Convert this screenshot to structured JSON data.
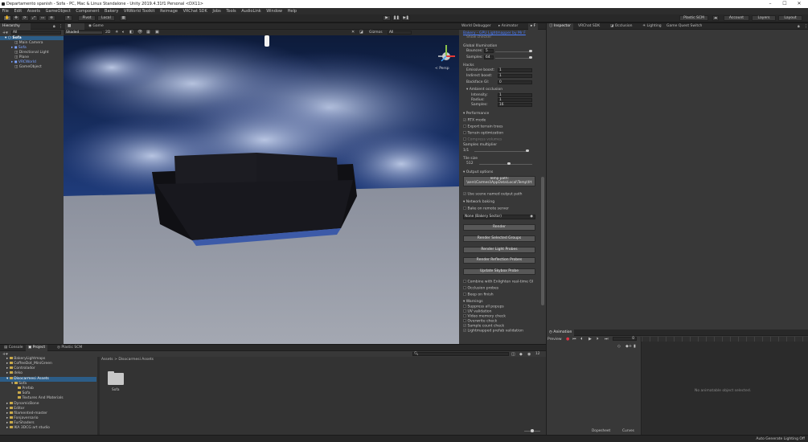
{
  "window": {
    "title": "Departamento spanish - Sofa - PC, Mac & Linux Standalone - Unity 2019.4.31f1 Personal <DX11>",
    "minimize": "–",
    "maximize": "☐",
    "close": "✕"
  },
  "menu": [
    "File",
    "Edit",
    "Assets",
    "GameObject",
    "Component",
    "Bakery",
    "VRWorld Toolkit",
    "Reimage",
    "VRChat SDK",
    "Jobs",
    "Tools",
    "AudioLink",
    "Window",
    "Help"
  ],
  "toolbar": {
    "pivot": "Pivot",
    "local": "Local",
    "plastic": "Plastic SCM",
    "account": "Account",
    "layers": "Layers",
    "layout": "Layout"
  },
  "hierarchy": {
    "tab": "Hierarchy",
    "search_placeholder": "All",
    "items": [
      "Sofa",
      "Main Camera",
      "Sofa",
      "Directional Light",
      "Plane",
      "VRCWorld",
      "GameObject"
    ]
  },
  "scene": {
    "tabs": [
      "Scene",
      "Game"
    ],
    "shading": "Shaded",
    "mode2d": "2D",
    "gizmos": "Gizmos",
    "search_placeholder": "All",
    "persp": "< Persp"
  },
  "bakery": {
    "tabs": [
      "World Debugger",
      "Animator",
      "F"
    ],
    "header_link": "Bakery - GPU Lightmapper by Mr F",
    "cutoff": "Show checker",
    "global_illumination": "Global Illumination",
    "bounces_label": "Bounces:",
    "bounces_value": "5",
    "samples_label": "Samples:",
    "samples_value": "64",
    "hacks": "Hacks",
    "emissive_label": "Emissive boost:",
    "emissive_value": "1",
    "indirect_label": "Indirect boost:",
    "indirect_value": "1",
    "backface_label": "Backface GI:",
    "backface_value": "0",
    "ao": "Ambient occlusion",
    "intensity_label": "Intensity:",
    "intensity_value": "1",
    "radius_label": "Radius:",
    "radius_value": "1",
    "ao_samples_label": "Samples:",
    "ao_samples_value": "16",
    "performance": "Performance",
    "rtx": "RTX mode",
    "export_terrain": "Export terrain trees",
    "terrain_opt": "Terrain optimization",
    "compress": "Compress volumes",
    "samples_mult": "Samples multiplier",
    "samples_mult_value": "1/1",
    "tile_size": "Tile size",
    "tile_value": "512",
    "output_options": "Output options",
    "temp_path_label": "Temp path:",
    "temp_path": "\\sers\\Carmesi\\AppData\\Local\\Temp\\frt",
    "use_scene_named": "Use scene named output path",
    "network_baking": "Network baking",
    "bake_remote": "Bake on remote server",
    "sector": "None (Bakery Sector)",
    "buttons": [
      "Render",
      "Render Selected Groups",
      "Render Light Probes",
      "Render Reflection Probes",
      "Update Skybox Probe"
    ],
    "combine": "Combine with Enlighten real-time GI",
    "occlusion_probes": "Occlusion probes",
    "beep": "Beep on finish",
    "warnings": "Warnings",
    "warn_items": [
      "Suppress all popups",
      "UV validation",
      "Video memory check",
      "Overwrite check",
      "Sample count check",
      "Lightmapped prefab validation"
    ]
  },
  "inspector": {
    "tabs": [
      "Inspector",
      "VRChat SDK",
      "Occlusion",
      "Lighting",
      "Game Quest Switch"
    ]
  },
  "animation": {
    "tab": "Animation",
    "preview": "Preview",
    "frame": "0",
    "empty": "No animatable object selected.",
    "dopesheet": "Dopesheet",
    "curves": "Curves"
  },
  "project": {
    "tabs": [
      "Console",
      "Project",
      "Plastic SCM"
    ],
    "search_placeholder": "",
    "count": "12",
    "tree": [
      "BakeryLightmaps",
      "CoffeeDot_MiniGreen",
      "Controlador",
      "deko",
      "Disocarmesi Assets",
      "Sofa",
      "Prefab",
      "Sofa",
      "Textures And Materials",
      "DynamicBone",
      "Editor",
      "filamented-master",
      "Fonjaversario",
      "FurShaders",
      "IKA 3DCG art studio"
    ],
    "breadcrumb_root": "Assets",
    "breadcrumb_sep": ">",
    "breadcrumb_current": "Disocarmesi Assets",
    "asset_label": "Sofa"
  },
  "status": {
    "text": "Auto Generate Lighting Off"
  },
  "colors": {
    "accent": "#2c5d87",
    "link": "#4c7eff",
    "panel": "#383838"
  }
}
